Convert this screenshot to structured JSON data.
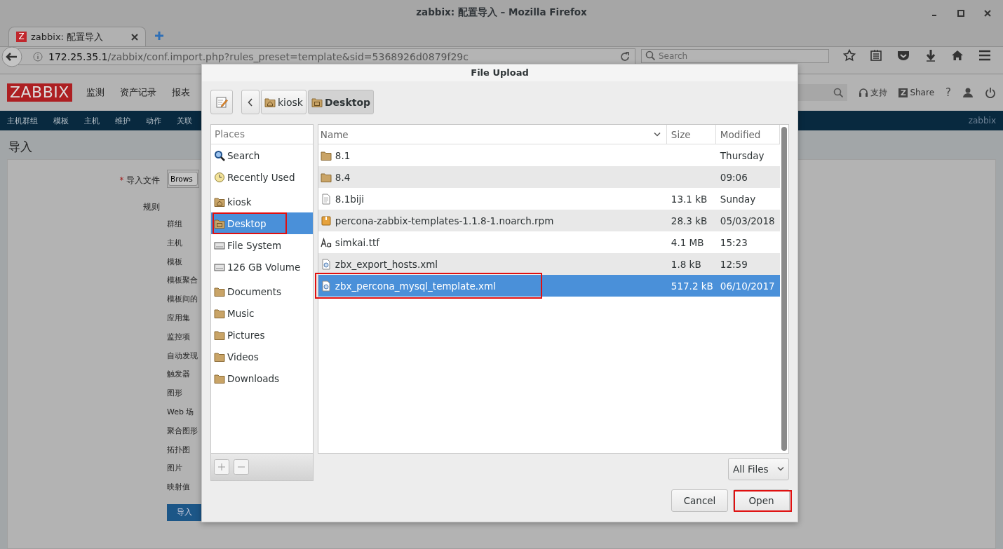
{
  "window": {
    "title": "zabbix: 配置导入 – Mozilla Firefox"
  },
  "browser": {
    "tabs": [
      {
        "title": "zabbix: 配置导入",
        "icon_letter": "Z",
        "selected": true
      }
    ],
    "url_host": "172.25.35.1",
    "url_path": "/zabbix/conf.import.php?rules_preset=template&sid=5368926d0879f29c",
    "search": {
      "placeholder": "Search"
    }
  },
  "zabbix": {
    "logo": "ZABBIX",
    "menu": [
      "监测",
      "资产记录",
      "报表"
    ],
    "support": "支持",
    "share_letter": "Z",
    "share": "Share",
    "help": "?",
    "submenu": [
      "主机群组",
      "模板",
      "主机",
      "维护",
      "动作",
      "关联"
    ],
    "server_name": "zabbix",
    "page_title": "导入",
    "form": {
      "required_mark": "*",
      "file_label": "导入文件",
      "browse": "Brows",
      "rules_label": "规则",
      "rules": [
        "群组",
        "主机",
        "模板",
        "模板聚合",
        "模板间的",
        "应用集",
        "监控项",
        "自动发现",
        "触发器",
        "图形",
        "Web 场",
        "聚合图形",
        "拓扑图",
        "图片",
        "映射值"
      ],
      "submit": "导入"
    }
  },
  "dialog": {
    "title": "File Upload",
    "path": [
      {
        "label": "kiosk",
        "kind": "home",
        "selected": false
      },
      {
        "label": "Desktop",
        "kind": "desktop",
        "selected": true
      }
    ],
    "places": {
      "header": "Places",
      "sections": [
        [
          {
            "label": "Search",
            "kind": "search",
            "selected": false,
            "marked": false
          },
          {
            "label": "Recently Used",
            "kind": "recent",
            "selected": false,
            "marked": false
          }
        ],
        [
          {
            "label": "kiosk",
            "kind": "home",
            "selected": false,
            "marked": false
          },
          {
            "label": "Desktop",
            "kind": "desktop",
            "selected": true,
            "marked": true
          },
          {
            "label": "File System",
            "kind": "drive",
            "selected": false,
            "marked": false
          },
          {
            "label": "126 GB Volume",
            "kind": "drive",
            "selected": false,
            "marked": false
          }
        ],
        [
          {
            "label": "Documents",
            "kind": "folder",
            "selected": false,
            "marked": false
          },
          {
            "label": "Music",
            "kind": "folder",
            "selected": false,
            "marked": false
          },
          {
            "label": "Pictures",
            "kind": "folder",
            "selected": false,
            "marked": false
          },
          {
            "label": "Videos",
            "kind": "folder",
            "selected": false,
            "marked": false
          },
          {
            "label": "Downloads",
            "kind": "folder",
            "selected": false,
            "marked": false
          }
        ]
      ]
    },
    "files": {
      "columns": [
        "Name",
        "Size",
        "Modified"
      ],
      "rows": [
        {
          "name": "8.1",
          "kind": "folder",
          "modified": "Thursday",
          "selected": false,
          "marked": false
        },
        {
          "name": "8.4",
          "kind": "folder",
          "modified": "09:06",
          "selected": false,
          "marked": false
        },
        {
          "name": "8.1biji",
          "kind": "text",
          "size": "13.1 kB",
          "modified": "Sunday",
          "selected": false,
          "marked": false
        },
        {
          "name": "percona-zabbix-templates-1.1.8-1.noarch.rpm",
          "kind": "package",
          "size": "28.3 kB",
          "modified": "05/03/2018",
          "selected": false,
          "marked": false
        },
        {
          "name": "simkai.ttf",
          "kind": "font",
          "size": "4.1 MB",
          "modified": "15:23",
          "selected": false,
          "marked": false
        },
        {
          "name": "zbx_export_hosts.xml",
          "kind": "xml",
          "size": "1.8 kB",
          "modified": "12:59",
          "selected": false,
          "marked": false
        },
        {
          "name": "zbx_percona_mysql_template.xml",
          "kind": "xml",
          "size": "517.2 kB",
          "modified": "06/10/2017",
          "selected": true,
          "marked": true
        }
      ]
    },
    "filter": "All Files",
    "buttons": [
      {
        "label": "Cancel",
        "marked": false
      },
      {
        "label": "Open",
        "marked": true
      }
    ]
  }
}
